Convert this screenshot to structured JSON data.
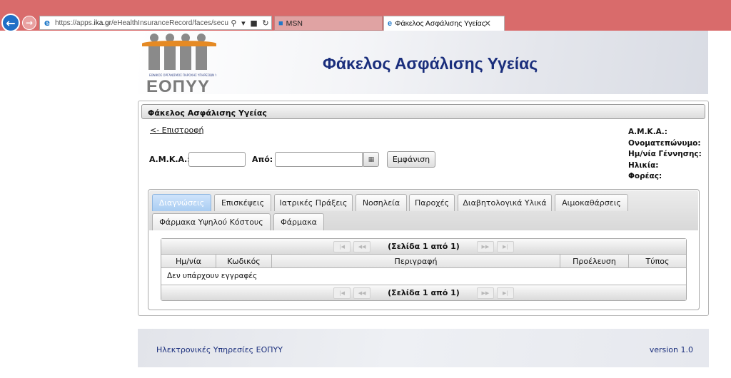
{
  "browser": {
    "url_prefix": "https://apps.",
    "url_domain": "ika.gr",
    "url_rest": "/eHealthInsuranceRecord/faces/secure/h",
    "tabs": [
      {
        "label": "MSN",
        "active": false
      },
      {
        "label": "Φάκελος Ασφάλισης Υγείας",
        "active": true
      }
    ],
    "close_glyph": "✕"
  },
  "banner": {
    "logo_text": "ΕΟΠΥΥ",
    "logo_tagline": "ΕΘΝΙΚΟΣ ΟΡΓΑΝΙΣΜΟΣ ΠΑΡΟΧΗΣ ΥΠΗΡΕΣΙΩΝ ΥΓΕΙΑΣ",
    "title": "Φάκελος Ασφάλισης Υγείας",
    "logo_colors": {
      "figures": "#8a8a8a",
      "arc": "#e58a24"
    }
  },
  "panel": {
    "header": "Φάκελος Ασφάλισης Υγείας",
    "back_link": "<- Επιστροφή",
    "search": {
      "amka_label": "Α.Μ.Κ.Α.:",
      "amka_value": "",
      "from_label": "Από:",
      "from_value": "",
      "show_button": "Εμφάνιση"
    },
    "info": {
      "amka": "Α.Μ.Κ.Α.:",
      "name": "Ονοματεπώνυμο:",
      "dob": "Ημ/νία Γέννησης:",
      "age": "Ηλικία:",
      "carrier": "Φορέας:"
    }
  },
  "tabs": [
    "Διαγνώσεις",
    "Επισκέψεις",
    "Ιατρικές Πράξεις",
    "Νοσηλεία",
    "Παροχές",
    "Διαβητολογικά Υλικά",
    "Αιμοκαθάρσεις",
    "Φάρμακα Υψηλού Κόστους",
    "Φάρμακα"
  ],
  "active_tab": "Διαγνώσεις",
  "table": {
    "page_info": "(Σελίδα 1 από 1)",
    "columns": [
      "Ημ/νία",
      "Κωδικός",
      "Περιγραφή",
      "Προέλευση",
      "Τύπος"
    ],
    "empty_message": "Δεν υπάρχουν εγγραφές"
  },
  "footer": {
    "left": "Ηλεκτρονικές Υπηρεσίες ΕΟΠΥΥ",
    "right": "version 1.0"
  },
  "colors": {
    "browser_chrome": "#d96b6b",
    "title_blue": "#1a2e7c",
    "active_tab": "#a9cdf2"
  }
}
